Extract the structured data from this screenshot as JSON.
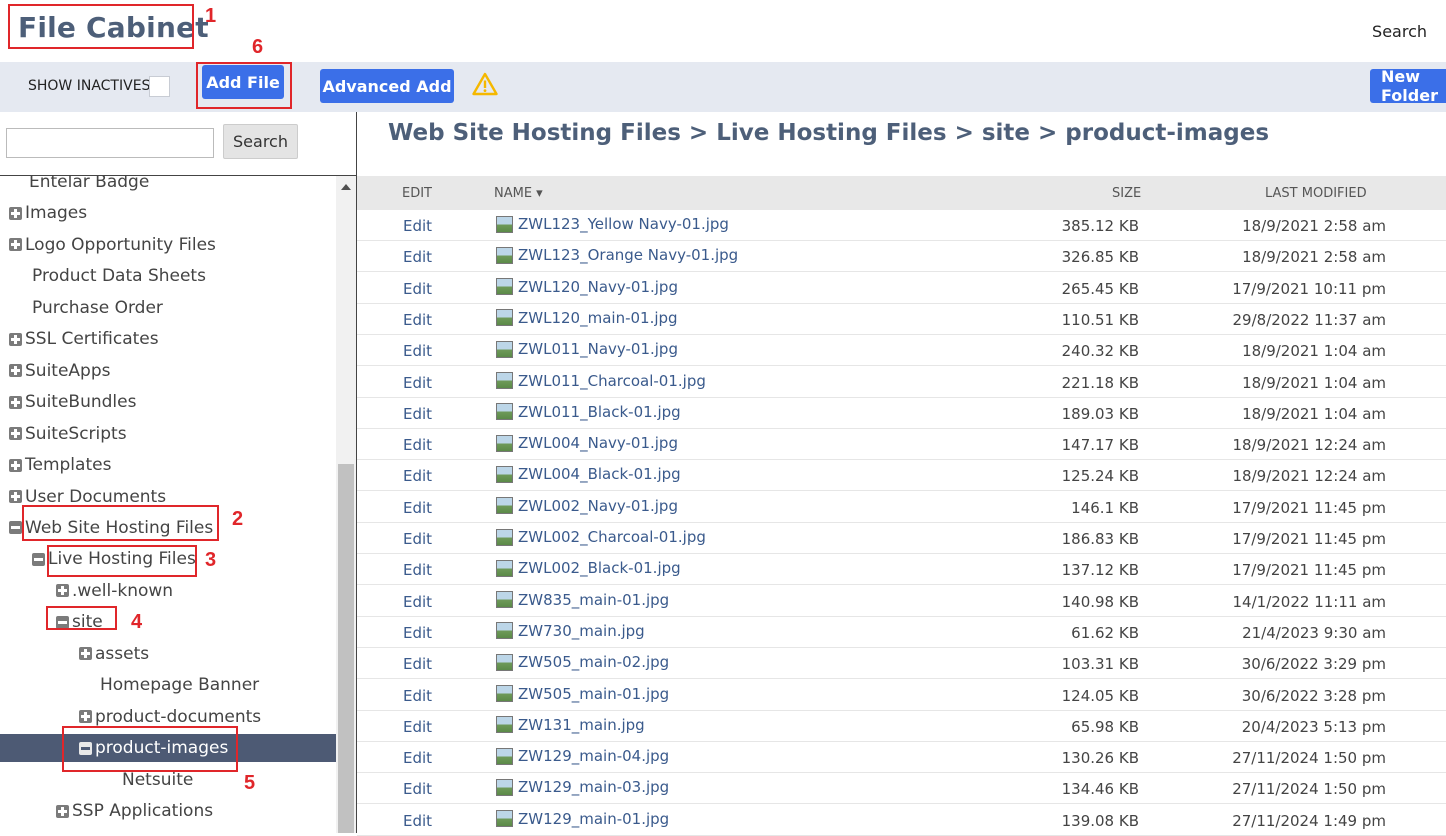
{
  "header": {
    "title": "File Cabinet",
    "search_label": "Search"
  },
  "toolbar": {
    "show_inactives_label": "SHOW INACTIVES",
    "add_file_label": "Add File",
    "advanced_add_label": "Advanced Add",
    "new_folder_label": "New Folder"
  },
  "left_search": {
    "button_label": "Search",
    "input_value": ""
  },
  "tree": [
    {
      "label": "Entelar Badge",
      "toggle": "none"
    },
    {
      "label": "Images",
      "toggle": "plus"
    },
    {
      "label": "Logo Opportunity Files",
      "toggle": "plus"
    },
    {
      "label": "Product Data Sheets",
      "toggle": "none"
    },
    {
      "label": "Purchase Order",
      "toggle": "none"
    },
    {
      "label": "SSL Certificates",
      "toggle": "plus"
    },
    {
      "label": "SuiteApps",
      "toggle": "plus"
    },
    {
      "label": "SuiteBundles",
      "toggle": "plus"
    },
    {
      "label": "SuiteScripts",
      "toggle": "plus"
    },
    {
      "label": "Templates",
      "toggle": "plus"
    },
    {
      "label": "User Documents",
      "toggle": "plus"
    },
    {
      "label": "Web Site Hosting Files",
      "toggle": "minus"
    },
    {
      "label": "Live Hosting Files",
      "toggle": "minus"
    },
    {
      "label": ".well-known",
      "toggle": "plus"
    },
    {
      "label": "site",
      "toggle": "minus"
    },
    {
      "label": "assets",
      "toggle": "plus"
    },
    {
      "label": "Homepage Banner",
      "toggle": "none"
    },
    {
      "label": "product-documents",
      "toggle": "plus"
    },
    {
      "label": "product-images",
      "toggle": "minus",
      "selected": true
    },
    {
      "label": "Netsuite",
      "toggle": "none"
    },
    {
      "label": "SSP Applications",
      "toggle": "plus"
    }
  ],
  "breadcrumb": "Web Site Hosting Files > Live Hosting Files > site > product-images",
  "table": {
    "columns": {
      "edit": "EDIT",
      "name": "NAME ▾",
      "size": "SIZE",
      "modified": "LAST MODIFIED"
    },
    "rows": [
      {
        "edit": "Edit",
        "name": "ZWL123_Yellow Navy-01.jpg",
        "size": "385.12 KB",
        "modified": "18/9/2021 2:58 am"
      },
      {
        "edit": "Edit",
        "name": "ZWL123_Orange Navy-01.jpg",
        "size": "326.85 KB",
        "modified": "18/9/2021 2:58 am"
      },
      {
        "edit": "Edit",
        "name": "ZWL120_Navy-01.jpg",
        "size": "265.45 KB",
        "modified": "17/9/2021 10:11 pm"
      },
      {
        "edit": "Edit",
        "name": "ZWL120_main-01.jpg",
        "size": "110.51 KB",
        "modified": "29/8/2022 11:37 am"
      },
      {
        "edit": "Edit",
        "name": "ZWL011_Navy-01.jpg",
        "size": "240.32 KB",
        "modified": "18/9/2021 1:04 am"
      },
      {
        "edit": "Edit",
        "name": "ZWL011_Charcoal-01.jpg",
        "size": "221.18 KB",
        "modified": "18/9/2021 1:04 am"
      },
      {
        "edit": "Edit",
        "name": "ZWL011_Black-01.jpg",
        "size": "189.03 KB",
        "modified": "18/9/2021 1:04 am"
      },
      {
        "edit": "Edit",
        "name": "ZWL004_Navy-01.jpg",
        "size": "147.17 KB",
        "modified": "18/9/2021 12:24 am"
      },
      {
        "edit": "Edit",
        "name": "ZWL004_Black-01.jpg",
        "size": "125.24 KB",
        "modified": "18/9/2021 12:24 am"
      },
      {
        "edit": "Edit",
        "name": "ZWL002_Navy-01.jpg",
        "size": "146.1 KB",
        "modified": "17/9/2021 11:45 pm"
      },
      {
        "edit": "Edit",
        "name": "ZWL002_Charcoal-01.jpg",
        "size": "186.83 KB",
        "modified": "17/9/2021 11:45 pm"
      },
      {
        "edit": "Edit",
        "name": "ZWL002_Black-01.jpg",
        "size": "137.12 KB",
        "modified": "17/9/2021 11:45 pm"
      },
      {
        "edit": "Edit",
        "name": "ZW835_main-01.jpg",
        "size": "140.98 KB",
        "modified": "14/1/2022 11:11 am"
      },
      {
        "edit": "Edit",
        "name": "ZW730_main.jpg",
        "size": "61.62 KB",
        "modified": "21/4/2023 9:30 am"
      },
      {
        "edit": "Edit",
        "name": "ZW505_main-02.jpg",
        "size": "103.31 KB",
        "modified": "30/6/2022 3:29 pm"
      },
      {
        "edit": "Edit",
        "name": "ZW505_main-01.jpg",
        "size": "124.05 KB",
        "modified": "30/6/2022 3:28 pm"
      },
      {
        "edit": "Edit",
        "name": "ZW131_main.jpg",
        "size": "65.98 KB",
        "modified": "20/4/2023 5:13 pm"
      },
      {
        "edit": "Edit",
        "name": "ZW129_main-04.jpg",
        "size": "130.26 KB",
        "modified": "27/11/2024 1:50 pm"
      },
      {
        "edit": "Edit",
        "name": "ZW129_main-03.jpg",
        "size": "134.46 KB",
        "modified": "27/11/2024 1:50 pm"
      },
      {
        "edit": "Edit",
        "name": "ZW129_main-01.jpg",
        "size": "139.08 KB",
        "modified": "27/11/2024 1:49 pm"
      }
    ]
  },
  "annotations": [
    "1",
    "2",
    "3",
    "4",
    "5",
    "6"
  ],
  "colors": {
    "accent": "#3b6fe8",
    "title": "#4d5f79",
    "annotation": "#e0262a",
    "selected_row": "#4d5a74",
    "warning": "#f5b800"
  },
  "icons": {
    "warning": "warning-triangle-icon",
    "file": "image-file-icon"
  }
}
